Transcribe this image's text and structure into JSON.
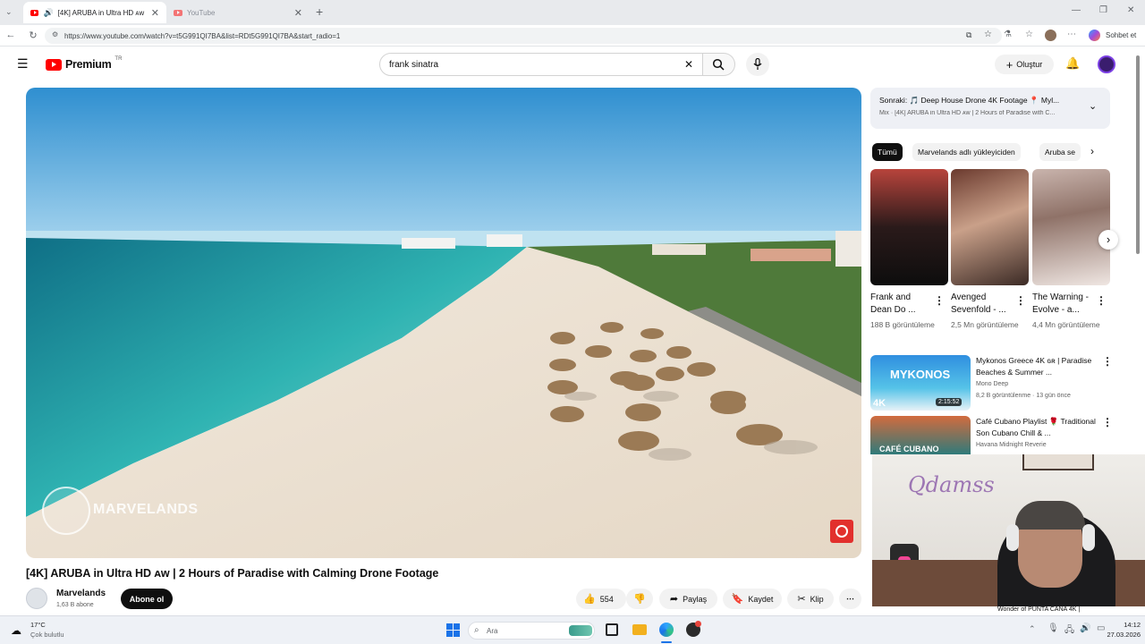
{
  "browser": {
    "tabs": [
      {
        "title": "[4K] ARUBA in Ultra HD ᴀᴡ | 2",
        "active": true
      },
      {
        "title": "YouTube",
        "active": false
      }
    ],
    "url": "https://www.youtube.com/watch?v=t5G991QI7BA&list=RDt5G991QI7BA&start_radio=1",
    "copilot_label": "Sohbet et"
  },
  "youtube": {
    "brand": "Premium",
    "region": "TR",
    "search_value": "frank sinatra",
    "create_label": "Oluştur"
  },
  "video": {
    "title": "[4K] ARUBA in Ultra HD ᴀᴡ | 2 Hours of Paradise with Calming Drone Footage",
    "watermark": "MARVELANDS",
    "channel": "Marvelands",
    "subscribers": "1,63 B abone",
    "subscribe_label": "Abone ol",
    "likes": "554",
    "share_label": "Paylaş",
    "save_label": "Kaydet",
    "clip_label": "Klip"
  },
  "sidebar": {
    "upnext_title": "Sonraki: 🎵 Deep House Drone 4K Footage 📍 Myl...",
    "upnext_sub": "Mix · [4K] ARUBA in Ultra HD ᴀᴡ | 2 Hours of Paradise with C...",
    "chips": [
      "Tümü",
      "Marvelands adlı yükleyiciden",
      "Aruba se"
    ],
    "cards": [
      {
        "title": "Frank and Dean Do ...",
        "views": "188 B görüntüleme"
      },
      {
        "title": "Avenged Sevenfold - ...",
        "views": "2,5 Mn görüntüleme"
      },
      {
        "title": "The Warning - Evolve - a...",
        "views": "4,4 Mn görüntüleme"
      }
    ],
    "list": [
      {
        "title": "Mykonos Greece 4K ɢʀ | Paradise Beaches & Summer ...",
        "channel": "Mono Deep",
        "meta": "8,2 B görüntülenme · 13 gün önce",
        "duration": "2:15:52",
        "thumb_text": "MYKONOS",
        "badge": "4K"
      },
      {
        "title": "Café Cubano Playlist 🌹 Traditional Son Cubano Chill & ...",
        "channel": "Havana Midnight Reverie",
        "meta": "",
        "thumb_text": "CAFÉ CUBANO"
      }
    ],
    "bottom_partial": "Wonder of PUNTA CANA 4K |"
  },
  "webcam": {
    "sign": "Qdamss"
  },
  "taskbar": {
    "temperature": "17°C",
    "weather": "Çok bulutlu",
    "search_placeholder": "Ara",
    "time": "14:12",
    "date": "27.03.2026"
  }
}
